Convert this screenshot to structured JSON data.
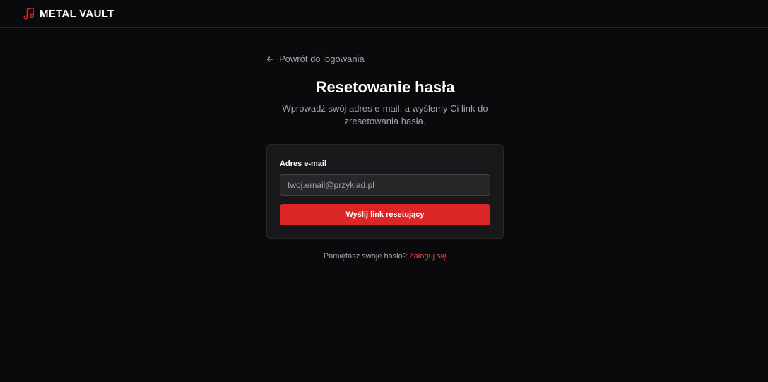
{
  "header": {
    "brand_name": "METAL VAULT",
    "brand_icon": "music-note-icon"
  },
  "back_link": {
    "label": "Powrót do logowania",
    "icon": "arrow-left-icon"
  },
  "page": {
    "title": "Resetowanie hasła",
    "subtitle": "Wprowadź swój adres e-mail, a wyślemy Ci link do zresetowania hasła."
  },
  "form": {
    "email_label": "Adres e-mail",
    "email_placeholder": "twoj.email@przyklad.pl",
    "email_value": "",
    "submit_label": "Wyślij link resetujący"
  },
  "footer": {
    "prompt": "Pamiętasz swoje hasło?",
    "login_link": "Zaloguj się"
  },
  "colors": {
    "background": "#0a0a0c",
    "card": "#18181b",
    "accent": "#dc2626",
    "link": "#ef4444",
    "muted_text": "#a1a1aa"
  }
}
